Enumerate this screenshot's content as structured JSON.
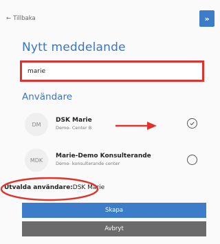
{
  "header": {
    "back_label": "Tillbaka",
    "back_icon": "arrow-left-icon",
    "expand_label": "»"
  },
  "title": "Nytt meddelande",
  "search": {
    "value": "marie"
  },
  "users_section": {
    "title": "Användare"
  },
  "users": [
    {
      "initials": "DM",
      "name": "DSK Marie",
      "subtitle": "Demo- Center B",
      "selected": true
    },
    {
      "initials": "MDK",
      "name": "Marie-Demo Konsulterande",
      "subtitle": "Demo- konsulterande center",
      "selected": false
    }
  ],
  "selected_users": {
    "label": "Utvalda användare:",
    "value": "DSK Marie"
  },
  "buttons": {
    "create": "Skapa",
    "cancel": "Avbryt"
  },
  "colors": {
    "accent": "#3d7cc9",
    "annotation_red": "#e0322b",
    "cancel_gray": "#6b6b6b"
  }
}
